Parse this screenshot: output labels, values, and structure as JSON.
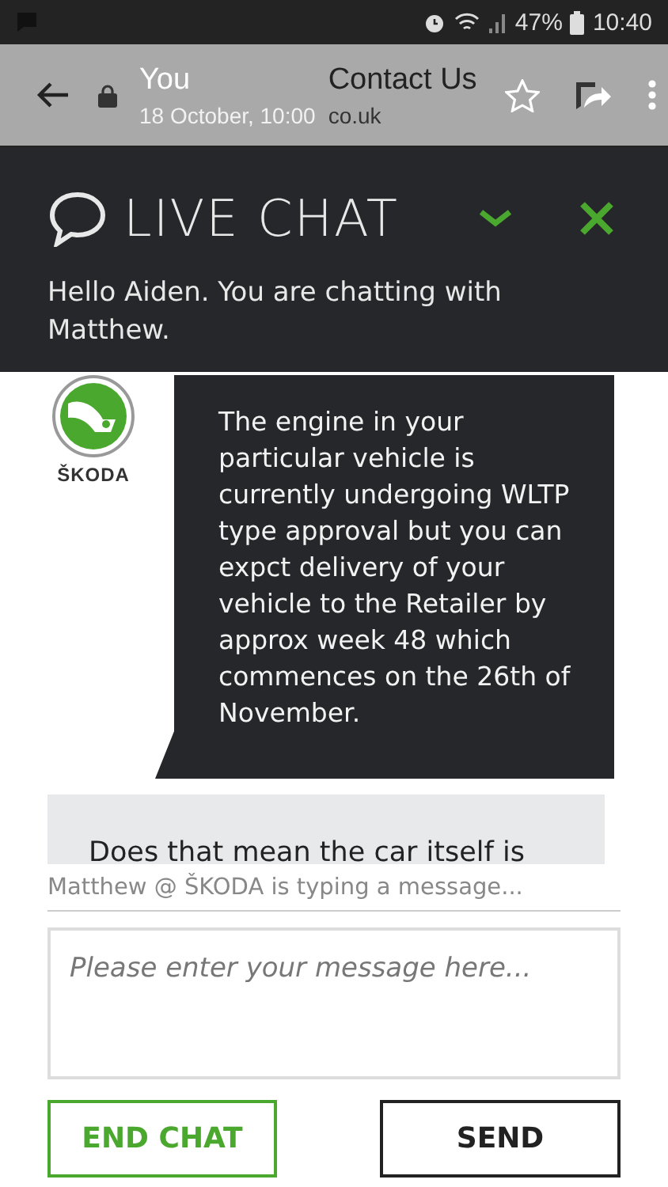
{
  "status_bar": {
    "battery": "47%",
    "time": "10:40"
  },
  "browser_bar": {
    "title": "Contact Us",
    "url": "co.uk",
    "notification": {
      "sender": "You",
      "time": "18 October, 10:00"
    }
  },
  "chat_header": {
    "title": "LIVE CHAT",
    "greeting": "Hello Aiden. You are chatting with Matthew."
  },
  "messages": [
    {
      "kind": "agent",
      "brand": "ŠKODA",
      "text": "The engine in your particular vehicle is currently undergoing WLTP type approval but you can expct delivery of your vehicle to the Retailer by approx week 48 which commences on the 26th of November."
    },
    {
      "kind": "user",
      "text": "Does that mean the car itself is"
    }
  ],
  "typing_indicator": "Matthew @ ŠKODA is typing a message...",
  "composer": {
    "placeholder": "Please enter your message here..."
  },
  "buttons": [
    {
      "kind": "secondary",
      "label": "END CHAT"
    },
    {
      "kind": "primary",
      "label": "SEND"
    }
  ]
}
